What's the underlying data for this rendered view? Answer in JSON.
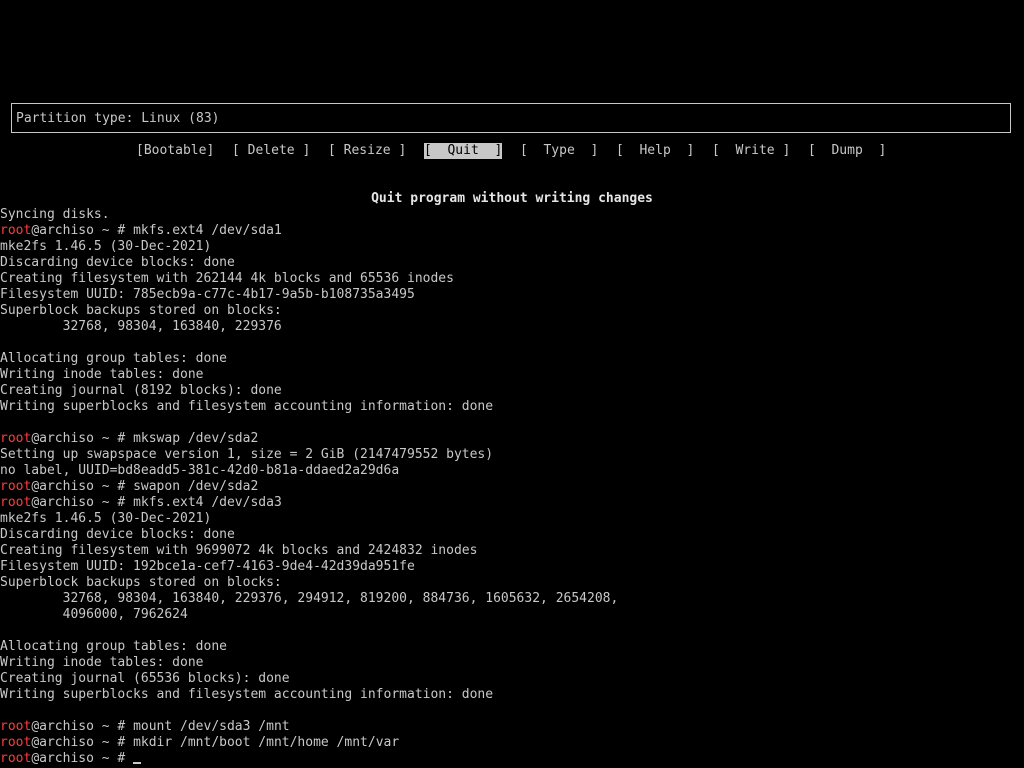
{
  "cfdisk": {
    "info_text": "Partition type: Linux (83)",
    "menu": [
      "[Bootable]",
      "[ Delete ]",
      "[ Resize ]",
      "[  Quit  ]",
      "[  Type  ]",
      "[  Help  ]",
      "[  Write ]",
      "[  Dump  ]"
    ],
    "selected": "[  Quit  ]",
    "hint": "Quit program without writing changes"
  },
  "terminal": {
    "user": "root",
    "host_prompt": "@archiso ~ # ",
    "lines": [
      {
        "type": "text",
        "text": "Syncing disks."
      },
      {
        "type": "cmd",
        "text": "mkfs.ext4 /dev/sda1"
      },
      {
        "type": "text",
        "text": "mke2fs 1.46.5 (30-Dec-2021)"
      },
      {
        "type": "text",
        "text": "Discarding device blocks: done"
      },
      {
        "type": "text",
        "text": "Creating filesystem with 262144 4k blocks and 65536 inodes"
      },
      {
        "type": "text",
        "text": "Filesystem UUID: 785ecb9a-c77c-4b17-9a5b-b108735a3495"
      },
      {
        "type": "text",
        "text": "Superblock backups stored on blocks:"
      },
      {
        "type": "text",
        "text": "        32768, 98304, 163840, 229376"
      },
      {
        "type": "text",
        "text": ""
      },
      {
        "type": "text",
        "text": "Allocating group tables: done"
      },
      {
        "type": "text",
        "text": "Writing inode tables: done"
      },
      {
        "type": "text",
        "text": "Creating journal (8192 blocks): done"
      },
      {
        "type": "text",
        "text": "Writing superblocks and filesystem accounting information: done"
      },
      {
        "type": "text",
        "text": ""
      },
      {
        "type": "cmd",
        "text": "mkswap /dev/sda2"
      },
      {
        "type": "text",
        "text": "Setting up swapspace version 1, size = 2 GiB (2147479552 bytes)"
      },
      {
        "type": "text",
        "text": "no label, UUID=bd8eadd5-381c-42d0-b81a-ddaed2a29d6a"
      },
      {
        "type": "cmd",
        "text": "swapon /dev/sda2"
      },
      {
        "type": "cmd",
        "text": "mkfs.ext4 /dev/sda3"
      },
      {
        "type": "text",
        "text": "mke2fs 1.46.5 (30-Dec-2021)"
      },
      {
        "type": "text",
        "text": "Discarding device blocks: done"
      },
      {
        "type": "text",
        "text": "Creating filesystem with 9699072 4k blocks and 2424832 inodes"
      },
      {
        "type": "text",
        "text": "Filesystem UUID: 192bce1a-cef7-4163-9de4-42d39da951fe"
      },
      {
        "type": "text",
        "text": "Superblock backups stored on blocks:"
      },
      {
        "type": "text",
        "text": "        32768, 98304, 163840, 229376, 294912, 819200, 884736, 1605632, 2654208,"
      },
      {
        "type": "text",
        "text": "        4096000, 7962624"
      },
      {
        "type": "text",
        "text": ""
      },
      {
        "type": "text",
        "text": "Allocating group tables: done"
      },
      {
        "type": "text",
        "text": "Writing inode tables: done"
      },
      {
        "type": "text",
        "text": "Creating journal (65536 blocks): done"
      },
      {
        "type": "text",
        "text": "Writing superblocks and filesystem accounting information: done"
      },
      {
        "type": "text",
        "text": ""
      },
      {
        "type": "cmd",
        "text": "mount /dev/sda3 /mnt"
      },
      {
        "type": "cmd",
        "text": "mkdir /mnt/boot /mnt/home /mnt/var"
      },
      {
        "type": "prompt",
        "text": ""
      }
    ]
  },
  "colors": {
    "background": "#000000",
    "foreground": "#c8c8c8",
    "user": "#ff3b3b"
  }
}
